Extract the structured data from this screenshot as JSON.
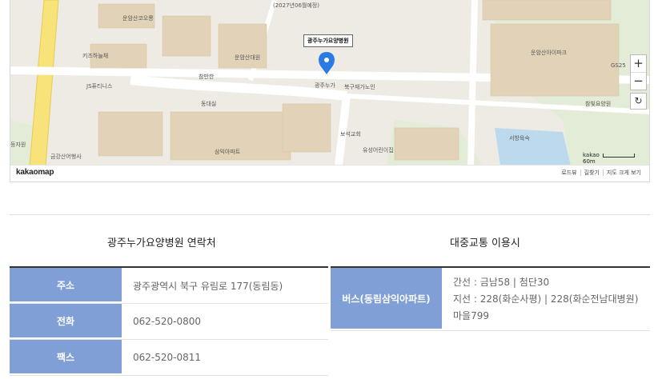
{
  "map": {
    "logo": "kakaomap",
    "footer_links": [
      "로드뷰",
      "길찾기",
      "지도 크게 보기"
    ],
    "zoom_in": "+",
    "zoom_out": "−",
    "refresh": "↻",
    "scale_brand": "kakao",
    "scale_value": "60m",
    "marker_label": "광주누가요양병원",
    "labels": [
      "(2027년06월예정)",
      "운암산코오롱 하늘채아파트",
      "키즈하늘채 어린이집",
      "JS퓨티니스",
      "운암산대원 로제비앙아파트",
      "광주누가 요양병원",
      "북구재가노인 요양센터",
      "참만한 불가교회",
      "동대실",
      "보석교회",
      "유성어린이집",
      "삼익아파트",
      "금강산어행사",
      "등자원",
      "운암산아이파크 아파트",
      "GS25",
      "참빛요양원",
      "서방육숙"
    ]
  },
  "contact": {
    "title": "광주누가요양병원 연락처",
    "address_label": "주소",
    "address_value": "광주광역시 북구 유림로 177(동림동)",
    "phone_label": "전화",
    "phone_value": "062-520-0800",
    "fax_label": "팩스",
    "fax_value": "062-520-0811"
  },
  "transit": {
    "title": "대중교통 이용시",
    "bus_label": "버스(동림삼익아파트)",
    "bus_lines": [
      "간선 : 금남58 | 첨단30",
      "지선 : 228(화순사평) | 228(화순전남대병원)",
      "마을799"
    ]
  }
}
